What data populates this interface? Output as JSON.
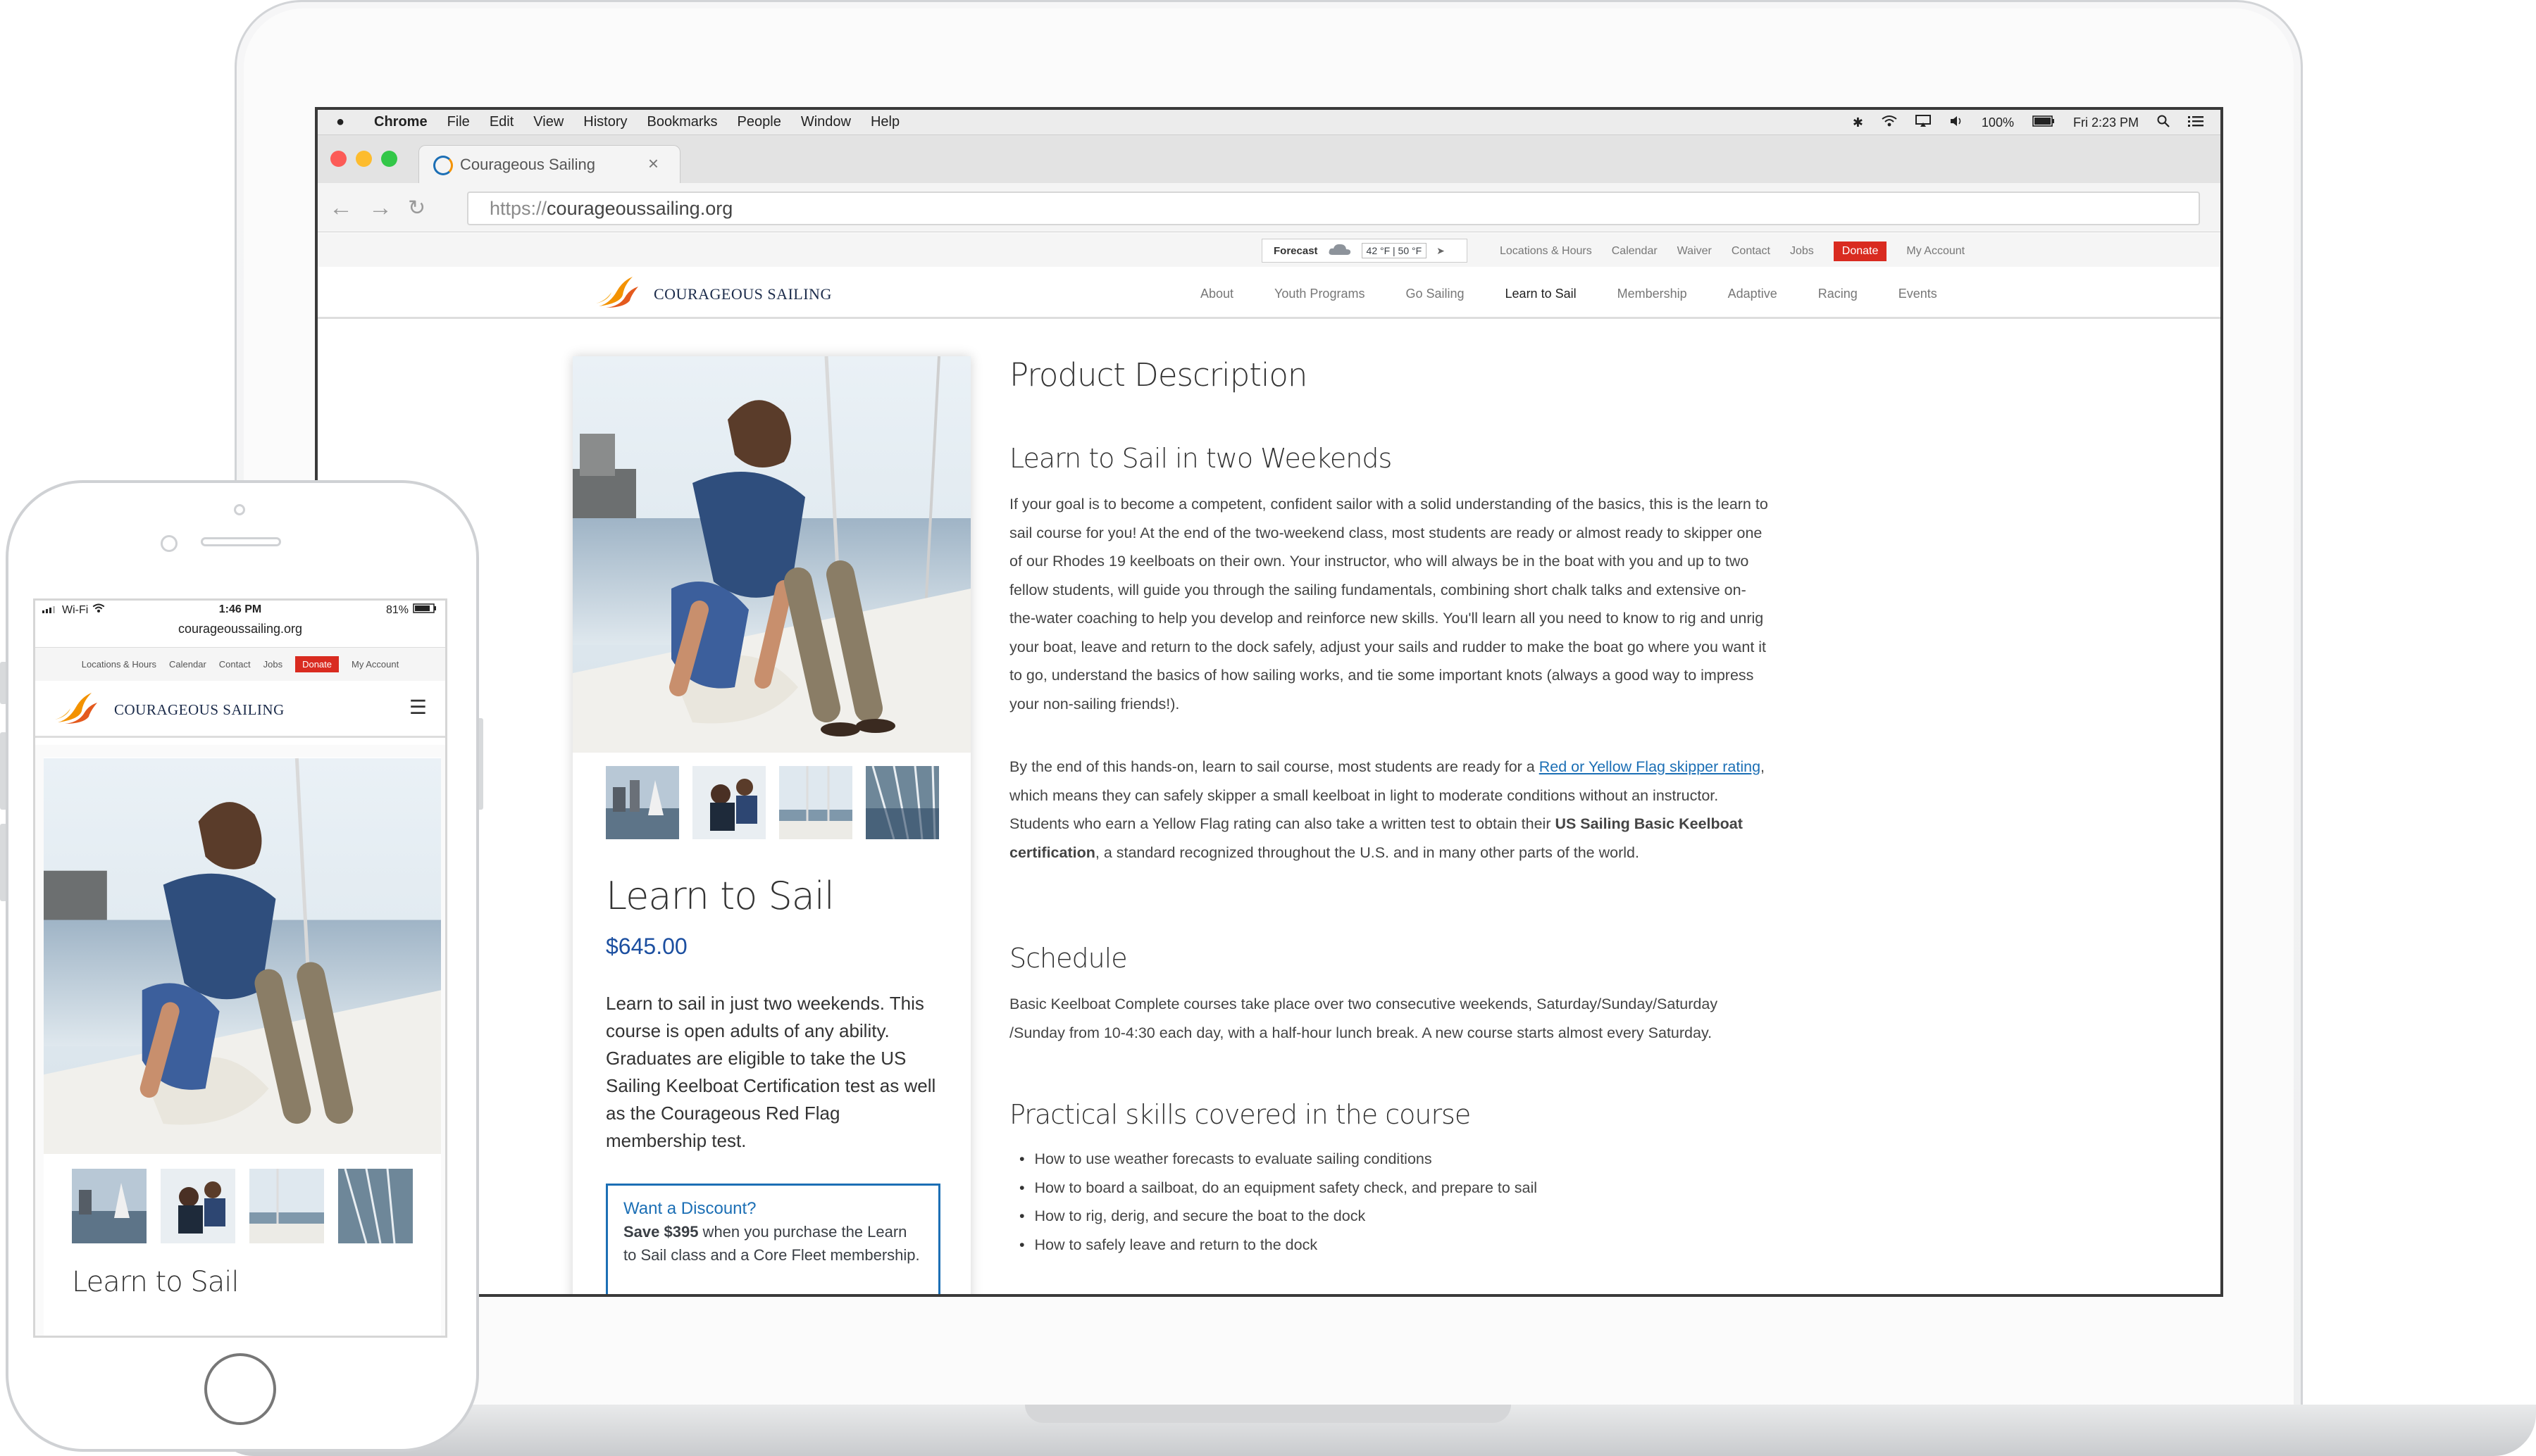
{
  "mac_menubar": {
    "app": "Chrome",
    "menus": [
      "File",
      "Edit",
      "View",
      "History",
      "Bookmarks",
      "People",
      "Window",
      "Help"
    ],
    "battery": "100%",
    "clock": "Fri 2:23 PM"
  },
  "browser": {
    "tab_title": "Courageous Sailing",
    "url_protocol": "https://",
    "url_host": "courageoussailing.org"
  },
  "site": {
    "forecast": {
      "label": "Forecast",
      "temps": "42 °F | 50 °F"
    },
    "top_links": [
      "Locations & Hours",
      "Calendar",
      "Waiver",
      "Contact",
      "Jobs"
    ],
    "donate": "Donate",
    "my_account": "My Account",
    "logo_text": "COURAGEOUS SAILING",
    "nav": [
      "About",
      "Youth Programs",
      "Go Sailing",
      "Learn to Sail",
      "Membership",
      "Adaptive",
      "Racing",
      "Events"
    ],
    "nav_active": "Learn to Sail"
  },
  "product": {
    "title": "Learn to Sail",
    "price": "$645.00",
    "description": "Learn to sail in just two weekends. This course is open adults of any ability. Graduates are eligible to take the US Sailing Keelboat Certification test as well as the Courageous Red Flag membership test.",
    "discount_title": "Want a Discount?",
    "discount_bold": "Save $395",
    "discount_text": " when you purchase the Learn to Sail class and a Core Fleet membership."
  },
  "details": {
    "heading": "Product Description",
    "section1_title": "Learn to Sail in two Weekends",
    "section1_p1": "If your goal is to become a competent, confident sailor with a solid understanding of the basics, this is the learn to sail course for you! At the end of the two-weekend class, most students are ready or almost ready to skipper one of our Rhodes 19 keelboats on their own. Your instructor, who will always be in the boat with you and up to two fellow students, will guide you through the sailing fundamentals, combining short chalk talks and extensive on-the-water coaching to help you develop and reinforce new skills. You'll learn all you need to know to rig and unrig your boat, leave and return to the dock safely, adjust your sails and rudder to make the boat go where you want it to go, understand the basics of how sailing works, and tie some important knots (always a good way to impress your non-sailing friends!).",
    "section1_p2_a": "By the end of this hands-on, learn to sail course, most students are ready for a ",
    "section1_p2_link": "Red or Yellow Flag skipper rating",
    "section1_p2_b": ", which means they can safely skipper a small keelboat in light to moderate conditions without an instructor. Students who earn a Yellow Flag rating can also take a written test to obtain their ",
    "section1_p2_bold": "US Sailing Basic Keelboat certification",
    "section1_p2_c": ", a standard recognized throughout the U.S. and in many other parts of the world.",
    "schedule_title": "Schedule",
    "schedule_text": "Basic Keelboat Complete courses take place over two consecutive weekends, Saturday/Sunday/Saturday /Sunday from 10-4:30 each day, with a half-hour lunch break.  A new course starts almost every Saturday.",
    "skills_title": "Practical skills covered in the course",
    "skills": [
      "How to use weather forecasts to evaluate sailing conditions",
      "How to board a sailboat, do an equipment safety check, and prepare to sail",
      "How to rig, derig, and secure the boat to the dock",
      "How to safely leave and return to the dock"
    ]
  },
  "phone": {
    "carrier": "Wi-Fi",
    "time": "1:46 PM",
    "battery": "81%",
    "url": "courageoussailing.org",
    "top_links": [
      "Locations & Hours",
      "Calendar",
      "Contact",
      "Jobs"
    ],
    "donate": "Donate",
    "my_account": "My Account",
    "logo_text": "COURAGEOUS SAILING",
    "product_title": "Learn to Sail"
  },
  "colors": {
    "accent_blue": "#1c6fb5",
    "donate_red": "#d92b20",
    "logo_orange": "#f39200"
  }
}
